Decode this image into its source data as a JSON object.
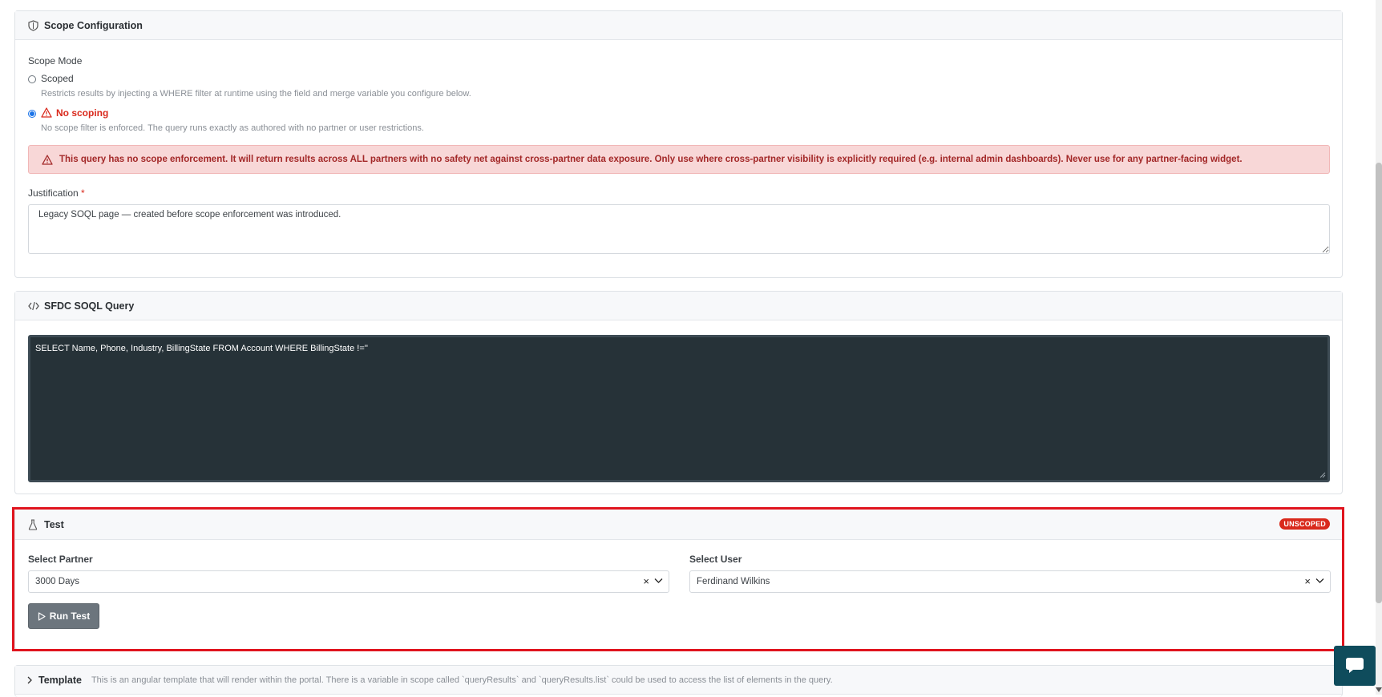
{
  "scope": {
    "header": "Scope Configuration",
    "mode_label": "Scope Mode",
    "scoped_label": "Scoped",
    "scoped_desc": "Restricts results by injecting a WHERE filter at runtime using the field and merge variable you configure below.",
    "noscope_label": "No scoping",
    "noscope_desc": "No scope filter is enforced. The query runs exactly as authored with no partner or user restrictions.",
    "selected": "No scoping",
    "warning": "This query has no scope enforcement. It will return results across ALL partners with no safety net against cross-partner data exposure. Only use where cross-partner visibility is explicitly required (e.g. internal admin dashboards). Never use for any partner-facing widget.",
    "justification_label": "Justification",
    "required_mark": "*",
    "justification_value": "Legacy SOQL page — created before scope enforcement was introduced."
  },
  "query": {
    "header": "SFDC SOQL Query",
    "soql": "SELECT Name, Phone, Industry, BillingState FROM Account WHERE BillingState !=''"
  },
  "test": {
    "header": "Test",
    "badge": "UNSCOPED",
    "partner_label": "Select Partner",
    "partner_value": "3000 Days",
    "user_label": "Select User",
    "user_value": "Ferdinand Wilkins",
    "clear_glyph": "×",
    "run_label": "Run Test"
  },
  "template": {
    "header": "Template",
    "desc": "This is an angular template that will render within the portal. There is a variable in scope called `queryResults` and `queryResults.list` could be used to access the list of elements in the query."
  },
  "colors": {
    "danger": "#d9291c",
    "alert_bg": "#f8d7d7",
    "code_bg": "#263238",
    "highlight": "#e0141e",
    "chat_bg": "#0f4c5c"
  }
}
